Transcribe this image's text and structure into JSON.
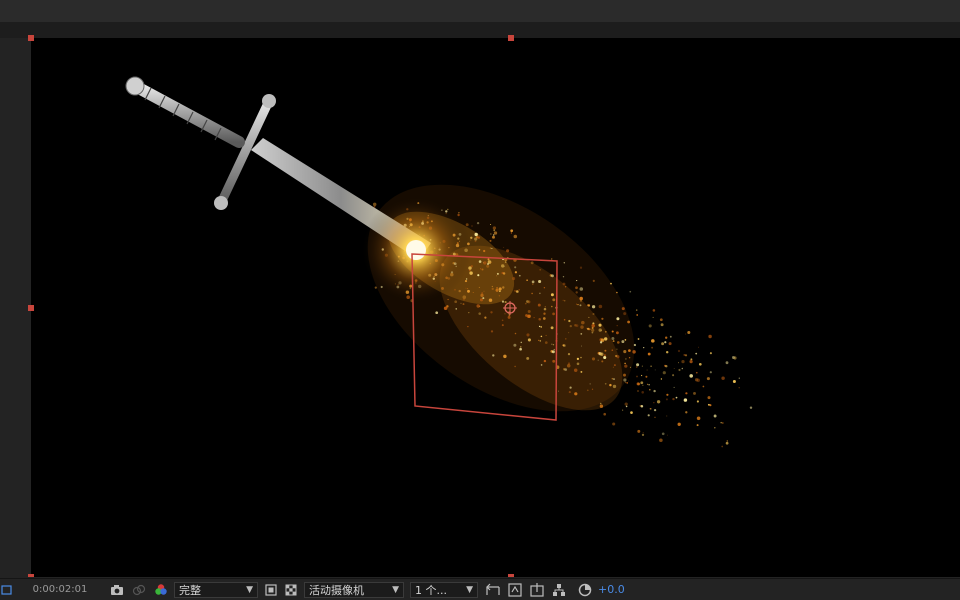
{
  "toolbar": {
    "timecode": "0:00:02:01",
    "resolution": "完整",
    "camera": "活动摄像机",
    "view_count": "1 个...",
    "exposure": "+0.0"
  },
  "icons": {
    "snapshot": "camera-icon",
    "show_snapshot": "show-snapshot-icon",
    "channel": "rgb-channel-icon",
    "region": "region-of-interest-icon",
    "transparency": "transparency-grid-icon",
    "reset_view": "reset-view-icon",
    "fast_preview": "fast-preview-icon",
    "timeline": "timeline-icon",
    "flowchart": "flowchart-icon",
    "exposure_reset": "reset-exposure-icon"
  },
  "colors": {
    "handle": "#c8453c",
    "frame": "#c8453c",
    "accent": "#4a8be6"
  }
}
